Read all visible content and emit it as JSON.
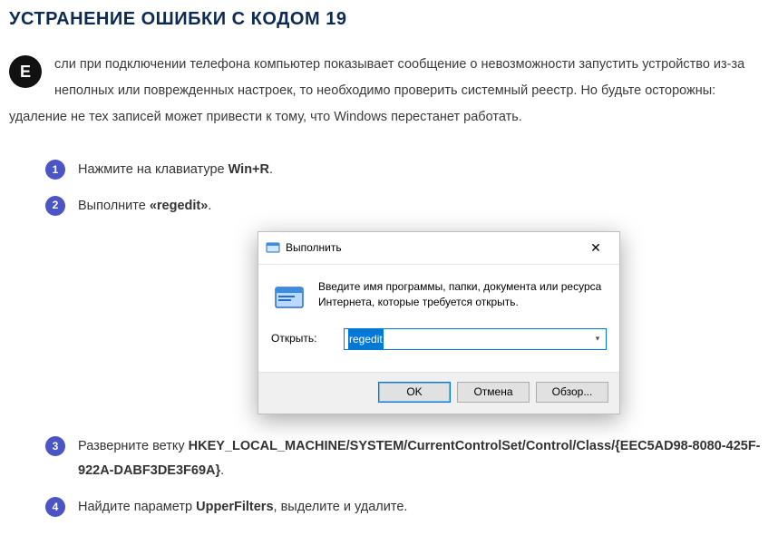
{
  "heading": "УСТРАНЕНИЕ ОШИБКИ С КОДОМ 19",
  "dropcap": "Е",
  "intro_rest": "сли при подключении телефона компьютер показывает сообщение о невозможности запустить устройство из-за неполных или поврежденных настроек, то необходимо проверить системный реестр. Но будьте осторожны: удаление не тех записей может привести к тому, что Windows перестанет работать.",
  "steps": {
    "s1a": "Нажмите на клавиатуре ",
    "s1b": "Win+R",
    "s1c": ".",
    "s2a": "Выполните ",
    "s2b": "«regedit»",
    "s2c": ".",
    "s3a": "Разверните ветку ",
    "s3b": "HKEY_LOCAL_MACHINE/SYSTEM/CurrentControlSet/Control/Class/{EEC5AD98-8080-425F-922A-DABF3DE3F69A}",
    "s3c": ".",
    "s4a": "Найдите параметр ",
    "s4b": "UpperFilters",
    "s4c": ", выделите и удалите."
  },
  "dialog": {
    "title": "Выполнить",
    "desc": "Введите имя программы, папки, документа или ресурса Интернета, которые требуется открыть.",
    "open_label": "Открыть:",
    "input_value": "regedit",
    "ok": "OK",
    "cancel": "Отмена",
    "browse": "Обзор...",
    "close_symbol": "✕"
  }
}
